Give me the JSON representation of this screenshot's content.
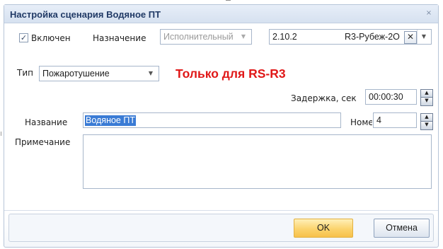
{
  "dialog": {
    "title": "Настройка сценария Водяное ПТ",
    "close_glyph": "×"
  },
  "enabled": {
    "checked": true,
    "check_glyph": "✓",
    "label": "Включен"
  },
  "purpose": {
    "label": "Назначение",
    "value": "Исполнительный",
    "disabled": true
  },
  "device": {
    "address": "2.10.2",
    "name": "R3-Рубеж-2О",
    "clear_glyph": "✕"
  },
  "type": {
    "label": "Тип",
    "value": "Пожаротушение"
  },
  "notice": {
    "text": "Только для RS-R3",
    "color": "#e01818"
  },
  "delay": {
    "label": "Задержка, сек",
    "value": "00:00:30"
  },
  "name": {
    "label": "Название",
    "value": "Водяное ПТ"
  },
  "number": {
    "label": "Номер",
    "value": "4"
  },
  "note": {
    "label": "Примечание",
    "value": ""
  },
  "buttons": {
    "ok_label": "OK",
    "cancel_label": "Отмена"
  },
  "icons": {
    "dropdown": "chevron-down-icon",
    "spin_up": "arrow-up-icon",
    "spin_down": "arrow-down-icon",
    "close": "close-icon",
    "clear": "clear-icon"
  },
  "colors": {
    "title_text": "#213a66",
    "selection": "#3a7bd5",
    "ok_button": "#fbd36d"
  }
}
